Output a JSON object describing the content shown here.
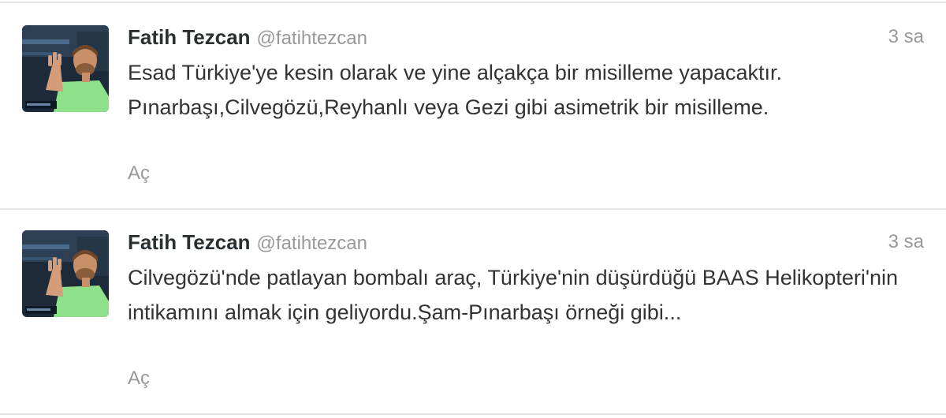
{
  "tweets": [
    {
      "name": "Fatih Tezcan",
      "handle": "@fatihtezcan",
      "time": "3 sa",
      "text": "Esad Türkiye'ye kesin olarak ve yine alçakça bir misilleme yapacaktır. Pınarbaşı,Cilvegözü,Reyhanlı veya Gezi gibi asimetrik bir misilleme.",
      "expand_label": "Aç"
    },
    {
      "name": "Fatih Tezcan",
      "handle": "@fatihtezcan",
      "time": "3 sa",
      "text": "Cilvegözü'nde patlayan bombalı araç, Türkiye'nin düşürdüğü BAAS Helikopteri'nin intikamını almak için geliyordu.Şam-Pınarbaşı örneği gibi...",
      "expand_label": "Aç"
    }
  ],
  "colors": {
    "name": "#292f33",
    "meta": "#999999",
    "text": "#333333",
    "divider": "#e6e6e6",
    "avatar_shirt": "#8fe08a",
    "avatar_background": "#1c2a3a"
  }
}
